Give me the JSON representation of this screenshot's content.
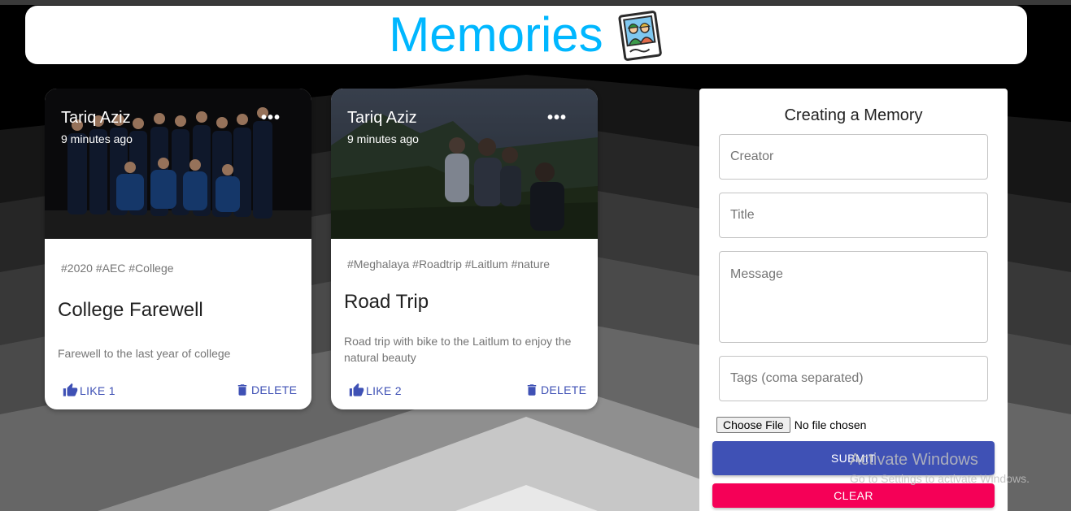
{
  "app": {
    "title": "Memories",
    "logo_icon": "photo-memories-icon"
  },
  "colors": {
    "accent": "#00b7ff",
    "primary": "#3f51b5",
    "secondary": "#f50057"
  },
  "posts": [
    {
      "creator": "Tariq Aziz",
      "time": "9 minutes ago",
      "tags": "#2020 #AEC #College",
      "title": "College Farewell",
      "message": "Farewell to the last year of college",
      "like_label": "LIKE 1",
      "delete_label": "DELETE",
      "more_label": "•••"
    },
    {
      "creator": "Tariq Aziz",
      "time": "9 minutes ago",
      "tags": "#Meghalaya #Roadtrip #Laitlum #nature",
      "title": "Road Trip",
      "message": "Road trip with bike to the Laitlum to enjoy the natural beauty",
      "like_label": "LIKE 2",
      "delete_label": "DELETE",
      "more_label": "•••"
    }
  ],
  "form": {
    "title": "Creating a Memory",
    "creator_placeholder": "Creator",
    "title_placeholder": "Title",
    "message_placeholder": "Message",
    "tags_placeholder": "Tags (coma separated)",
    "file_button": "Choose File",
    "file_status": "No file chosen",
    "submit_label": "SUBMIT",
    "clear_label": "CLEAR"
  },
  "watermark": {
    "line1": "Activate Windows",
    "line2": "Go to Settings to activate Windows."
  }
}
